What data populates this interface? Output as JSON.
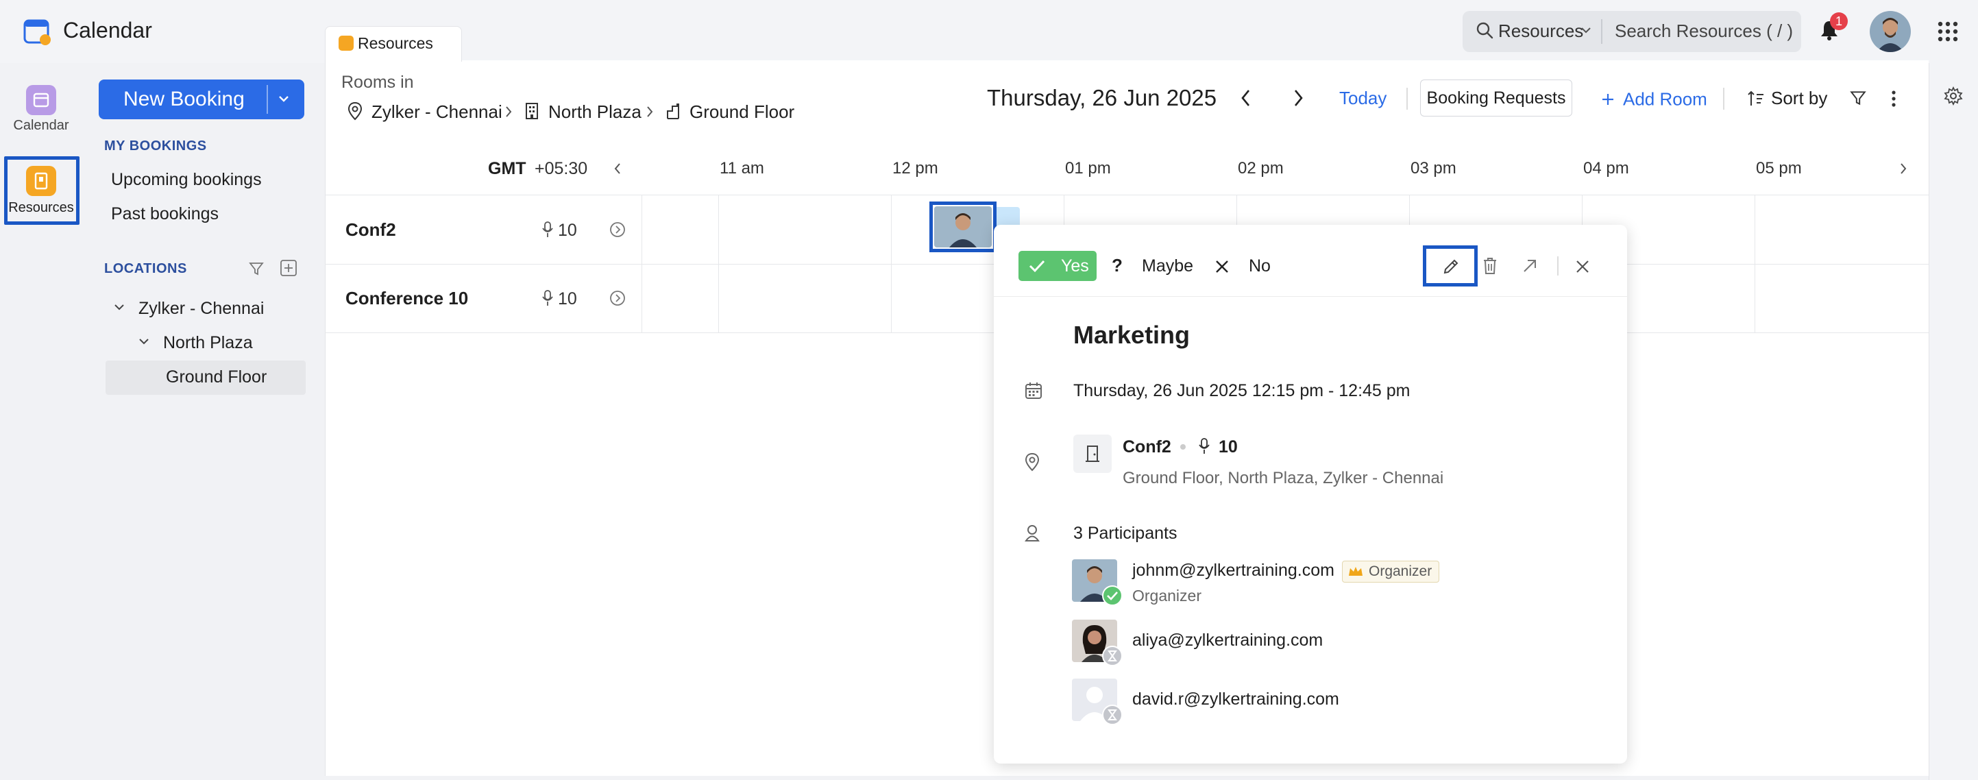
{
  "app": {
    "title": "Calendar"
  },
  "search": {
    "scope": "Resources",
    "placeholder": "Search Resources ( / )"
  },
  "notifications": {
    "count": "1"
  },
  "rail": {
    "calendar_label": "Calendar",
    "resources_label": "Resources"
  },
  "sidebar": {
    "new_booking_label": "New Booking",
    "my_bookings_heading": "MY BOOKINGS",
    "upcoming_bookings": "Upcoming bookings",
    "past_bookings": "Past bookings",
    "locations_heading": "LOCATIONS",
    "tree": [
      "Zylker - Chennai",
      "North Plaza",
      "Ground Floor"
    ]
  },
  "tab": {
    "label": "Resources"
  },
  "header": {
    "rooms_in": "Rooms in",
    "breadcrumb": [
      "Zylker - Chennai",
      "North Plaza",
      "Ground Floor"
    ],
    "date": "Thursday, 26 Jun 2025",
    "today": "Today",
    "booking_requests": "Booking Requests",
    "add_room": "Add Room",
    "sort_by": "Sort by"
  },
  "timeline": {
    "tz_label": "GMT",
    "tz_offset": "+05:30",
    "hours": [
      "11 am",
      "12 pm",
      "01 pm",
      "02 pm",
      "03 pm",
      "04 pm",
      "05 pm"
    ],
    "rooms": [
      {
        "name": "Conf2",
        "capacity": "10"
      },
      {
        "name": "Conference 10",
        "capacity": "10"
      }
    ]
  },
  "popover": {
    "rsvp": {
      "yes": "Yes",
      "maybe_symbol": "?",
      "maybe": "Maybe",
      "no": "No"
    },
    "title": "Marketing",
    "datetime": "Thursday, 26 Jun 2025 12:15 pm - 12:45 pm",
    "room": {
      "name": "Conf2",
      "capacity": "10",
      "path": "Ground Floor, North Plaza, Zylker - Chennai"
    },
    "participants_count": "3 Participants",
    "organizer_tag": "Organizer",
    "participants": [
      {
        "email": "johnm@zylkertraining.com",
        "role": "Organizer",
        "status": "accepted"
      },
      {
        "email": "aliya@zylkertraining.com",
        "status": "pending"
      },
      {
        "email": "david.r@zylkertraining.com",
        "status": "pending"
      }
    ]
  },
  "colors": {
    "accent": "#2b6be6",
    "highlight_box": "#1a57c4",
    "resources_icon": "#f5a623",
    "calendar_icon": "#b89be6",
    "accept_green": "#5cc470",
    "event_block": "#c9e6fb",
    "badge_red": "#e5404a"
  },
  "icons": [
    "calendar-logo-icon",
    "search-icon",
    "chevron-down-icon",
    "bell-icon",
    "apps-grid-icon",
    "filter-icon",
    "add-icon",
    "pin-icon",
    "building-icon",
    "floor-icon",
    "chevron-left-icon",
    "chevron-right-icon",
    "plus-icon",
    "sort-icon",
    "more-icon",
    "settings-icon",
    "info-icon",
    "mic-icon",
    "check-icon",
    "x-icon",
    "edit-icon",
    "trash-icon",
    "open-external-icon",
    "close-icon",
    "crown-icon",
    "person-icon",
    "door-icon",
    "hourglass-icon"
  ]
}
